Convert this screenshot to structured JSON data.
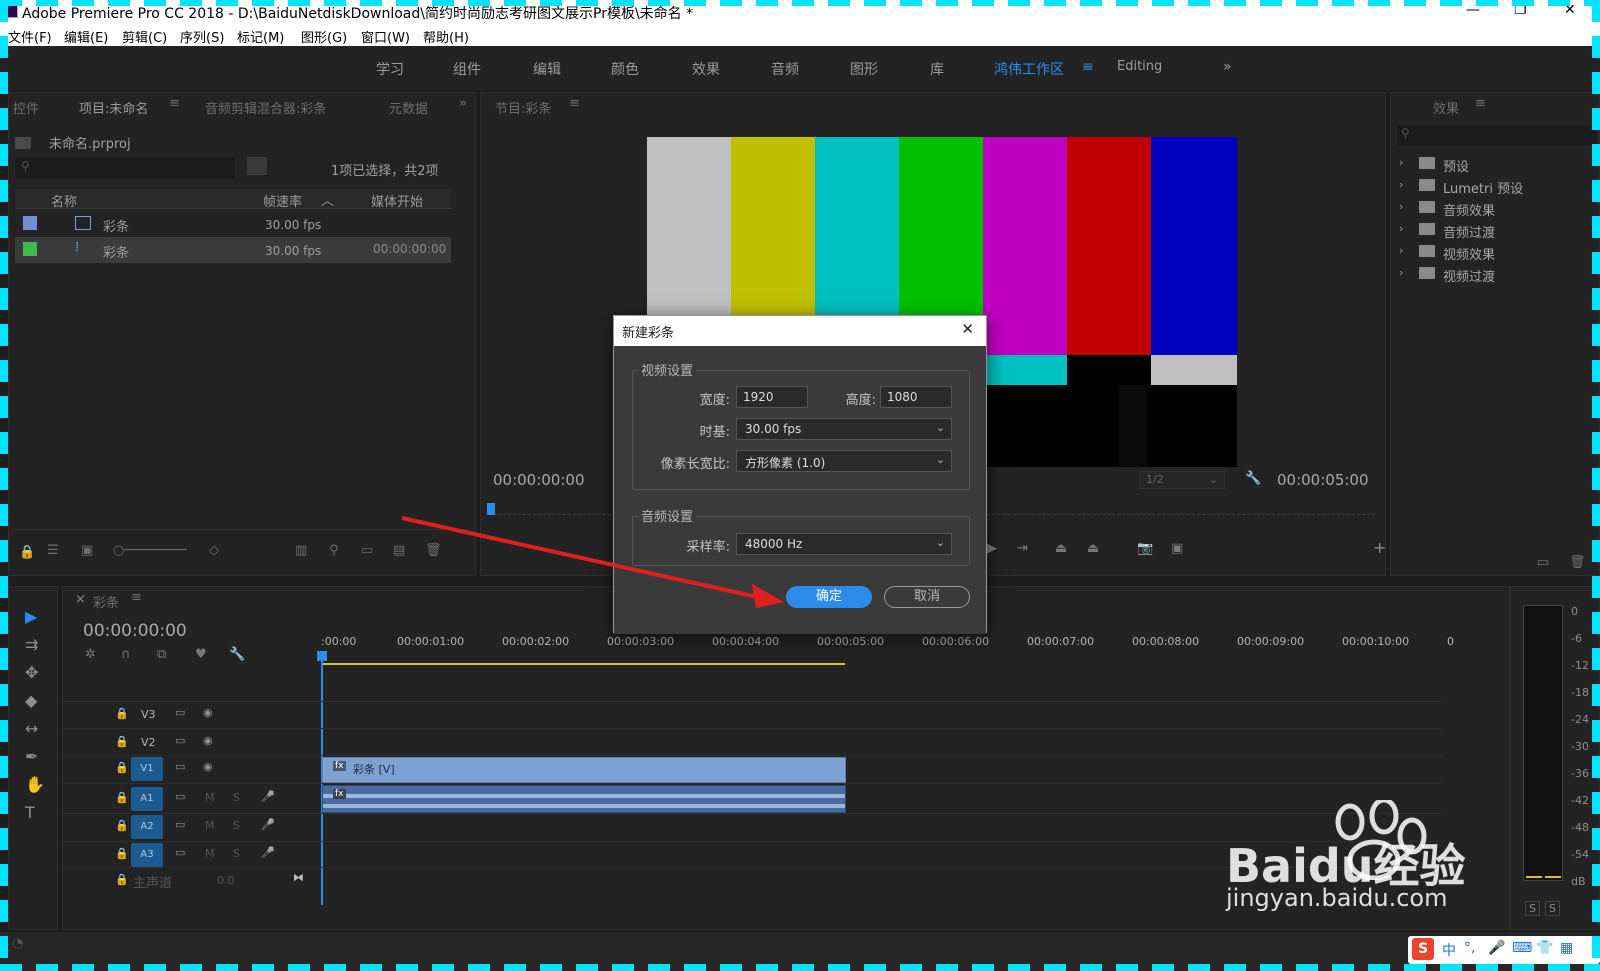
{
  "titlebar": {
    "title": "Adobe Premiere Pro CC 2018 - D:\\BaiduNetdiskDownload\\简约时尚励志考研图文展示Pr模板\\未命名 *"
  },
  "menu": [
    "文件(F)",
    "编辑(E)",
    "剪辑(C)",
    "序列(S)",
    "标记(M)",
    "图形(G)",
    "窗口(W)",
    "帮助(H)"
  ],
  "workspaces": [
    "学习",
    "组件",
    "编辑",
    "颜色",
    "效果",
    "音频",
    "图形",
    "库",
    "鸿伟工作区",
    "Editing"
  ],
  "project_panel": {
    "tabs": [
      "控件",
      "项目:未命名",
      "音频剪辑混合器:彩条",
      "元数据"
    ],
    "project_file": "未命名.prproj",
    "selection_info": "1项已选择，共2项",
    "columns": [
      "名称",
      "帧速率",
      "媒体开始"
    ],
    "rows": [
      {
        "name": "彩条",
        "fps": "30.00 fps",
        "start": "",
        "color": "#6f8fd8"
      },
      {
        "name": "彩条",
        "fps": "30.00 fps",
        "start": "00:00:00:00",
        "color": "#3fb950"
      }
    ]
  },
  "program_monitor": {
    "tab": "节目:彩条",
    "timecode_left": "00:00:00:00",
    "timecode_right": "00:00:05:00",
    "zoom": "1/2"
  },
  "effects_panel": {
    "tab": "效果",
    "items": [
      "预设",
      "Lumetri 预设",
      "音频效果",
      "音频过渡",
      "视频效果",
      "视频过渡"
    ]
  },
  "dialog": {
    "title": "新建彩条",
    "video_group": "视频设置",
    "width_label": "宽度:",
    "width_value": "1920",
    "height_label": "高度:",
    "height_value": "1080",
    "timebase_label": "时基:",
    "timebase_value": "30.00 fps",
    "par_label": "像素长宽比:",
    "par_value": "方形像素 (1.0)",
    "audio_group": "音频设置",
    "samplerate_label": "采样率:",
    "samplerate_value": "48000 Hz",
    "ok": "确定",
    "cancel": "取消"
  },
  "timeline": {
    "tab": "彩条",
    "timecode": "00:00:00:00",
    "ruler": [
      ":00:00",
      "00:00:01:00",
      "00:00:02:00",
      "00:00:03:00",
      "00:00:04:00",
      "00:00:05:00",
      "00:00:06:00",
      "00:00:07:00",
      "00:00:08:00",
      "00:00:09:00",
      "00:00:10:00",
      "0"
    ],
    "tracks": [
      "V3",
      "V2",
      "V1",
      "A1",
      "A2",
      "A3"
    ],
    "master": "主声道",
    "master_value": "0.0",
    "clip_label": "彩条 [V]",
    "fx": "fx",
    "m": "M",
    "s": "S"
  },
  "meter": {
    "ticks": [
      "0",
      "-6",
      "-12",
      "-18",
      "-24",
      "-30",
      "-36",
      "-42",
      "-48",
      "-54",
      "dB"
    ],
    "solo": [
      "S",
      "S"
    ]
  },
  "watermark": {
    "brand": "Baidu经验",
    "url": "jingyan.baidu.com"
  },
  "ime": {
    "label": "中"
  },
  "bars_colors": [
    "#c0c0c0",
    "#c0c000",
    "#00c0c0",
    "#00c000",
    "#c000c0",
    "#c00000",
    "#0000c0"
  ],
  "colors": {
    "accent": "#2d8ceb",
    "arrow": "#e02020"
  }
}
